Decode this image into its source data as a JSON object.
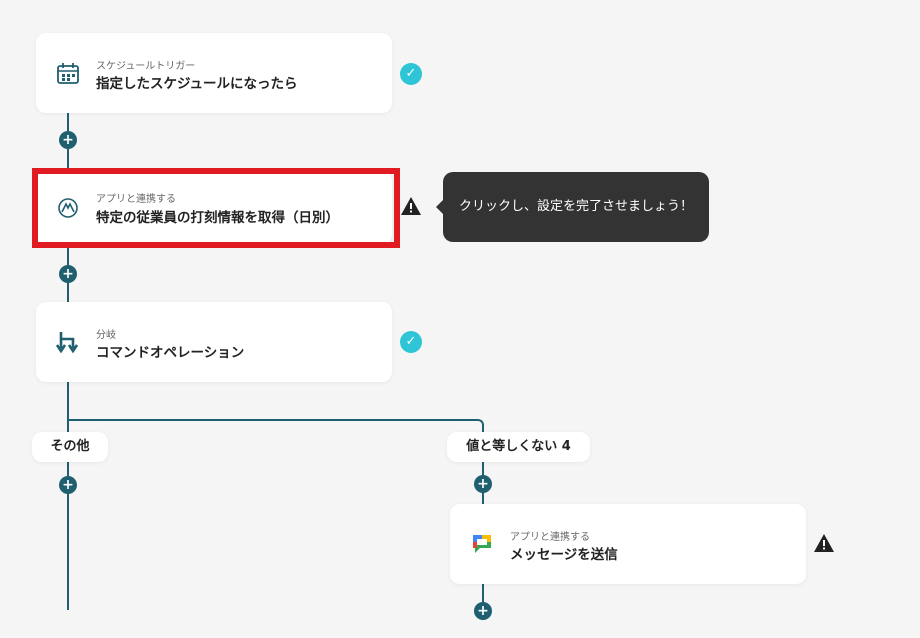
{
  "steps": [
    {
      "subtitle": "スケジュールトリガー",
      "title": "指定したスケジュールになったら",
      "icon": "calendar-icon",
      "status": "complete"
    },
    {
      "subtitle": "アプリと連携する",
      "title": "特定の従業員の打刻情報を取得（日別）",
      "icon": "app-logo-icon",
      "status": "warning"
    },
    {
      "subtitle": "分岐",
      "title": "コマンドオペレーション",
      "icon": "branch-icon",
      "status": "complete"
    },
    {
      "subtitle": "アプリと連携する",
      "title": "メッセージを送信",
      "icon": "chat-icon",
      "status": "warning"
    }
  ],
  "branches": {
    "left": "その他",
    "right": "値と等しくない 4"
  },
  "tooltip": "クリックし、設定を完了させましょう！",
  "colors": {
    "line": "#1f5f6f",
    "check": "#2ec6d6",
    "highlight": "#e11b22",
    "tooltip_bg": "#333333"
  }
}
